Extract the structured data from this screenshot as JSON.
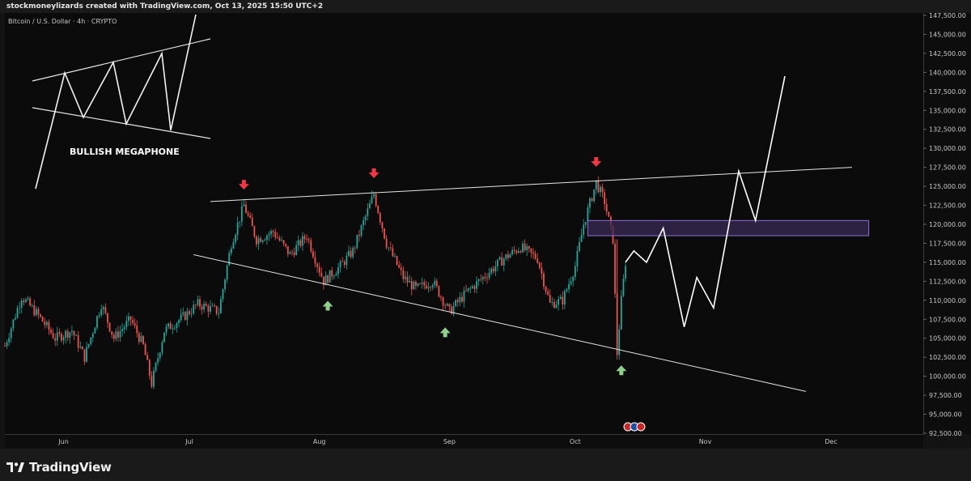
{
  "header": {
    "credit": "stockmoneylizards created with TradingView.com, Oct 13, 2025 15:50 UTC+2"
  },
  "chart_header": {
    "symbol": "Bitcoin / U.S. Dollar · 4h · CRYPTO"
  },
  "footer": {
    "brand": "TradingView"
  },
  "colors": {
    "up": "#26a69a",
    "down": "#ef5350",
    "arrow_down": "#f23645",
    "arrow_up": "#8fd18b",
    "zone_fill": "#3b2b55",
    "zone_border": "#8e6fd4"
  },
  "chart_data": {
    "type": "candlestick",
    "title": "Bitcoin / U.S. Dollar · 4h · CRYPTO",
    "annotation": "BULLISH MEGAPHONE",
    "ylim": [
      92500,
      147500
    ],
    "xlim": [
      "2025-05-18",
      "2025-12-23"
    ],
    "y_ticks": [
      92500,
      95000,
      97500,
      100000,
      102500,
      105000,
      107500,
      110000,
      112500,
      115000,
      117500,
      120000,
      122500,
      125000,
      127500,
      130000,
      132500,
      135000,
      137500,
      140000,
      142500,
      145000,
      147500
    ],
    "y_tick_labels": [
      "92,500.00",
      "95,000.00",
      "97,500.00",
      "100,000.00",
      "102,500.00",
      "105,000.00",
      "107,500.00",
      "110,000.00",
      "112,500.00",
      "115,000.00",
      "117,500.00",
      "120,000.00",
      "122,500.00",
      "125,000.00",
      "127,500.00",
      "130,000.00",
      "132,500.00",
      "135,000.00",
      "137,500.00",
      "140,000.00",
      "142,500.00",
      "145,000.00",
      "147,500.00"
    ],
    "x_ticks": [
      {
        "label": "Jun",
        "date": "2025-06-01"
      },
      {
        "label": "Jul",
        "date": "2025-07-01"
      },
      {
        "label": "Aug",
        "date": "2025-08-01"
      },
      {
        "label": "Sep",
        "date": "2025-09-01"
      },
      {
        "label": "Oct",
        "date": "2025-10-01"
      },
      {
        "label": "Nov",
        "date": "2025-11-01"
      },
      {
        "label": "Dec",
        "date": "2025-12-01"
      }
    ],
    "price_path": [
      [
        "2025-05-18",
        104000
      ],
      [
        "2025-05-22",
        110500
      ],
      [
        "2025-05-26",
        108000
      ],
      [
        "2025-05-30",
        105000
      ],
      [
        "2025-06-03",
        106000
      ],
      [
        "2025-06-06",
        102500
      ],
      [
        "2025-06-10",
        109500
      ],
      [
        "2025-06-13",
        105000
      ],
      [
        "2025-06-17",
        107500
      ],
      [
        "2025-06-20",
        104000
      ],
      [
        "2025-06-22",
        99000
      ],
      [
        "2025-06-25",
        106000
      ],
      [
        "2025-06-30",
        108000
      ],
      [
        "2025-07-03",
        109500
      ],
      [
        "2025-07-08",
        108500
      ],
      [
        "2025-07-11",
        117500
      ],
      [
        "2025-07-14",
        122500
      ],
      [
        "2025-07-17",
        118000
      ],
      [
        "2025-07-21",
        119000
      ],
      [
        "2025-07-25",
        116000
      ],
      [
        "2025-07-29",
        118500
      ],
      [
        "2025-08-02",
        112500
      ],
      [
        "2025-08-06",
        114500
      ],
      [
        "2025-08-09",
        116500
      ],
      [
        "2025-08-14",
        124000
      ],
      [
        "2025-08-17",
        117500
      ],
      [
        "2025-08-21",
        113000
      ],
      [
        "2025-08-24",
        111500
      ],
      [
        "2025-08-28",
        112500
      ],
      [
        "2025-09-01",
        108500
      ],
      [
        "2025-09-05",
        111000
      ],
      [
        "2025-09-10",
        113500
      ],
      [
        "2025-09-14",
        115500
      ],
      [
        "2025-09-18",
        117000
      ],
      [
        "2025-09-22",
        115500
      ],
      [
        "2025-09-25",
        109500
      ],
      [
        "2025-09-28",
        110000
      ],
      [
        "2025-10-01",
        114500
      ],
      [
        "2025-10-03",
        120000
      ],
      [
        "2025-10-06",
        125500
      ],
      [
        "2025-10-08",
        123000
      ],
      [
        "2025-10-10",
        118000
      ],
      [
        "2025-10-11",
        103000
      ],
      [
        "2025-10-12",
        110000
      ],
      [
        "2025-10-13",
        115000
      ]
    ],
    "projection": [
      [
        "2025-10-13",
        115000
      ],
      [
        "2025-10-15",
        116500
      ],
      [
        "2025-10-18",
        115000
      ],
      [
        "2025-10-22",
        119500
      ],
      [
        "2025-10-27",
        106500
      ],
      [
        "2025-10-30",
        113000
      ],
      [
        "2025-11-03",
        109000
      ],
      [
        "2025-11-09",
        127000
      ],
      [
        "2025-11-13",
        120500
      ],
      [
        "2025-11-20",
        139500
      ]
    ],
    "trendlines": [
      {
        "name": "upper",
        "from": [
          "2025-07-06",
          123000
        ],
        "to": [
          "2025-12-06",
          127500
        ]
      },
      {
        "name": "lower",
        "from": [
          "2025-07-02",
          116000
        ],
        "to": [
          "2025-11-25",
          98000
        ]
      }
    ],
    "zone": {
      "from": "2025-10-04",
      "to": "2025-12-10",
      "y_low": 118500,
      "y_high": 120500
    },
    "arrows": [
      {
        "type": "down",
        "date": "2025-07-14",
        "price": 125000
      },
      {
        "type": "down",
        "date": "2025-08-14",
        "price": 126500
      },
      {
        "type": "down",
        "date": "2025-10-06",
        "price": 128000
      },
      {
        "type": "up",
        "date": "2025-08-03",
        "price": 109500
      },
      {
        "type": "up",
        "date": "2025-08-31",
        "price": 106000
      },
      {
        "type": "up",
        "date": "2025-10-12",
        "price": 101000
      }
    ]
  }
}
